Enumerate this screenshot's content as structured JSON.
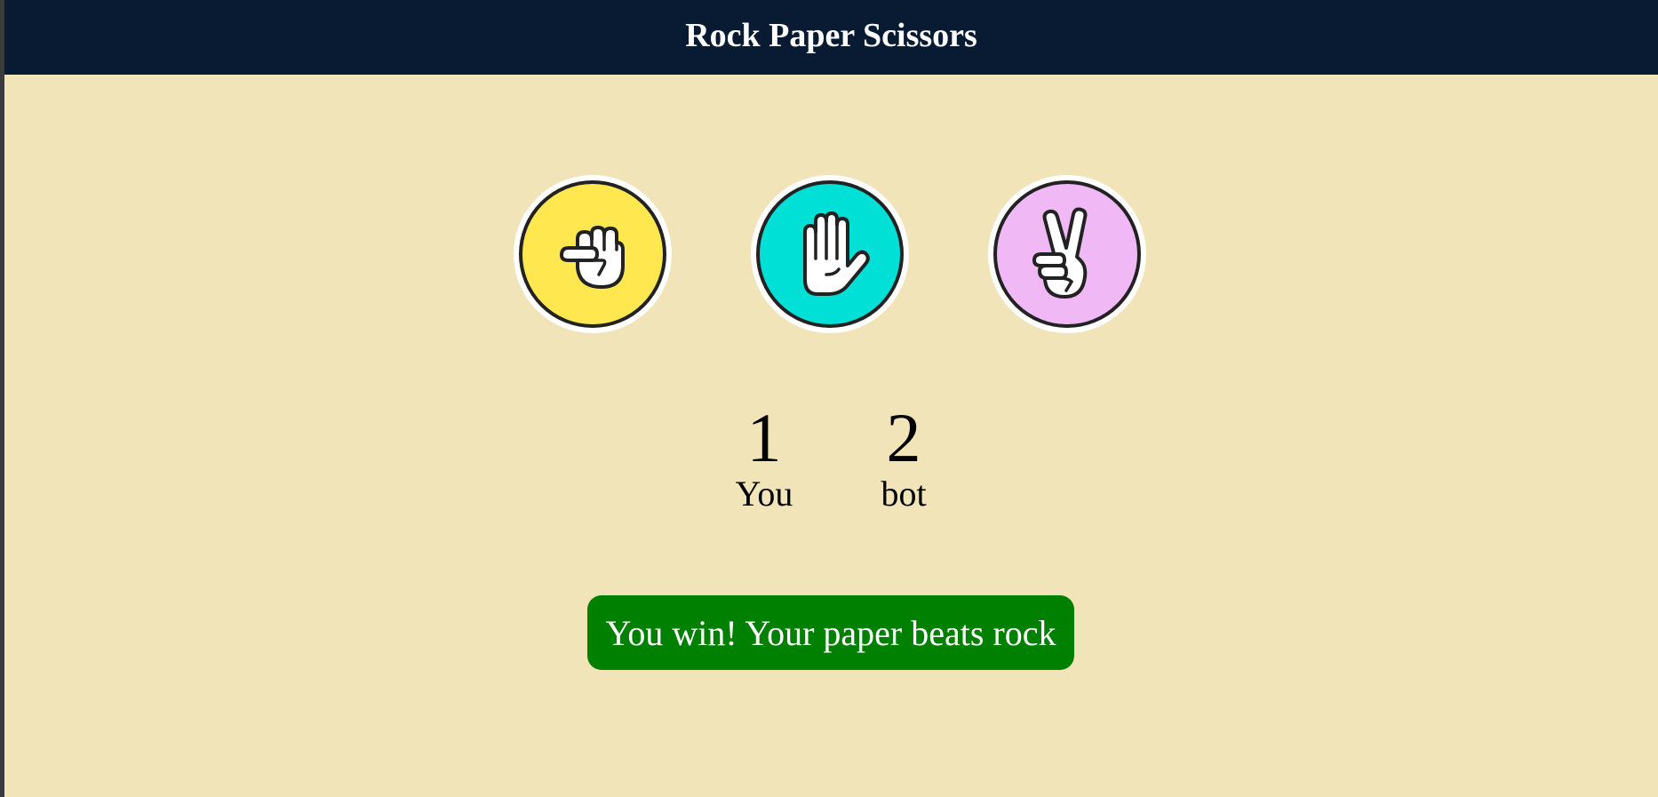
{
  "header": {
    "title": "Rock Paper Scissors"
  },
  "choices": [
    {
      "name": "rock",
      "icon": "rock-fist-icon",
      "color": "#ffe84f"
    },
    {
      "name": "paper",
      "icon": "paper-hand-icon",
      "color": "#00e0d6"
    },
    {
      "name": "scissors",
      "icon": "scissors-victory-icon",
      "color": "#f0b8f4"
    }
  ],
  "score": {
    "you": {
      "value": "1",
      "label": "You"
    },
    "bot": {
      "value": "2",
      "label": "bot"
    }
  },
  "result": {
    "text": "You win! Your paper beats rock",
    "color": "#008000"
  },
  "colors": {
    "background": "#f2e4b9",
    "header": "#091b33"
  }
}
